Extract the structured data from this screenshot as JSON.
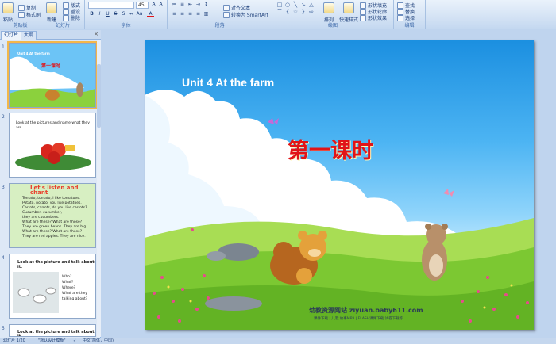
{
  "ribbon": {
    "clipboard": {
      "paste_label": "粘贴",
      "copy_label": "复制",
      "format_label": "格式刷",
      "group_label": "剪贴板"
    },
    "slides": {
      "new_label": "新建",
      "layout_label": "版式",
      "reset_label": "重设",
      "delete_label": "删除",
      "group_label": "幻灯片"
    },
    "font": {
      "size_value": "45",
      "group_label": "字体"
    },
    "paragraph": {
      "align_text_label": "对齐文本",
      "smartart_label": "转换为 SmartArt",
      "group_label": "段落"
    },
    "drawing": {
      "arrange_label": "排列",
      "quick_styles_label": "快速样式",
      "fill_label": "形状填充",
      "outline_label": "形状轮廓",
      "effects_label": "形状效果",
      "group_label": "绘图"
    },
    "editing": {
      "find_label": "查找",
      "replace_label": "替换",
      "select_label": "选择",
      "group_label": "编辑"
    }
  },
  "panel": {
    "tabs": [
      "幻灯片",
      "大纲"
    ],
    "slides": [
      {
        "num": "1",
        "title": "Unit 4 At the farm",
        "subtitle": "第一课时"
      },
      {
        "num": "2",
        "text": "Look at the pictures and name what they are."
      },
      {
        "num": "3",
        "heading": "Let's listen and chant",
        "lines": [
          "Tomato, tomato, I like tomatoes.",
          "Potato, potato, you like potatoes.",
          "Carrots, carrots, do you like carrots?",
          "Cucumber, cucumber,",
          "they are cucumbers.",
          "What are these? What are those?",
          "They are green beans. They are big.",
          "What are these? What are those?",
          "They are red apples. They are nice."
        ]
      },
      {
        "num": "4",
        "heading": "Look at the picture and talk about it.",
        "lines": [
          "Who?",
          "What?",
          "Where?",
          "What are they",
          "talking about?"
        ]
      },
      {
        "num": "5",
        "heading": "Look at the picture and talk about it."
      }
    ]
  },
  "slide": {
    "title": "Unit 4  At the farm",
    "subtitle": "第一课时",
    "watermark_site": "幼教资源网站  ziyuan.baby611.com",
    "watermark_links": "课件下载  |  儿歌  故事MP3  |  FLASH课件下载  试卷下载等"
  },
  "status": {
    "slide_counter": "幻灯片 1/20",
    "theme": "\"默认设计模板\"",
    "language": "中文(简体，中国)"
  }
}
